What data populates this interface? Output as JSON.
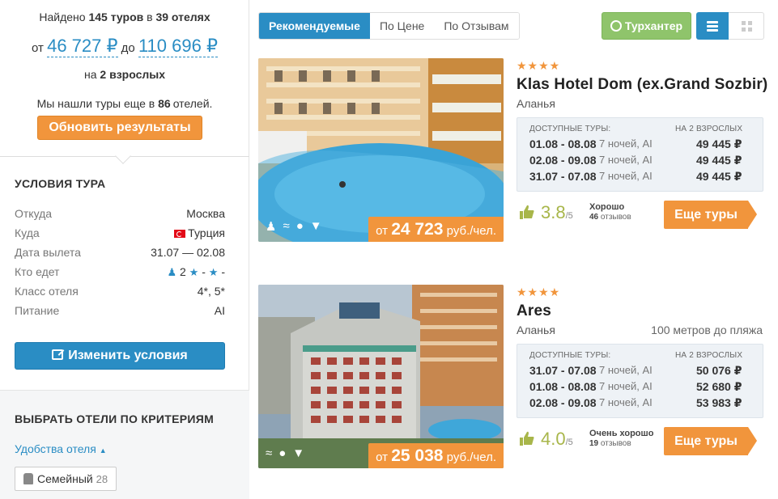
{
  "summary": {
    "found_prefix": "Найдено",
    "tours_count": "145 туров",
    "in": "в",
    "hotels_count": "39 отелях",
    "from_label": "от",
    "price_min": "46 727 ₽",
    "to_label": "до",
    "price_max": "110 696 ₽",
    "adults_prefix": "на",
    "adults": "2 взрослых",
    "more_prefix": "Мы нашли туры еще в",
    "more_count": "86",
    "more_suffix": "отелей.",
    "update_button": "Обновить результаты"
  },
  "conditions": {
    "title": "УСЛОВИЯ ТУРА",
    "rows": [
      {
        "label": "Откуда",
        "value": "Москва"
      },
      {
        "label": "Куда",
        "value": "Турция"
      },
      {
        "label": "Дата вылета",
        "value": "31.07 — 02.08"
      },
      {
        "label": "Кто едет",
        "value": "2"
      },
      {
        "label": "Класс отеля",
        "value": "4*, 5*"
      },
      {
        "label": "Питание",
        "value": "AI"
      }
    ],
    "travellers_sep": "-",
    "change_button": "Изменить условия"
  },
  "filters": {
    "title": "ВЫБРАТЬ ОТЕЛИ ПО КРИТЕРИЯМ",
    "amenities_label": "Удобства отеля",
    "chip_label": "Семейный",
    "chip_count": "28"
  },
  "toolbar": {
    "sort_recommended": "Рекомендуемые",
    "sort_price": "По Цене",
    "sort_reviews": "По Отзывам",
    "hunter_button": "Турхантер"
  },
  "hotels": [
    {
      "stars": "★★★★",
      "name": "Klas Hotel Dom (ex.Grand Sozbir)",
      "city": "Аланья",
      "beach": "",
      "price_from": "от",
      "price": "24 723",
      "price_unit": "руб./чел.",
      "tours_header": "ДОСТУПНЫЕ ТУРЫ:",
      "for_header": "НА 2 ВЗРОСЛЫХ",
      "tours": [
        {
          "dates": "01.08 - 08.08",
          "nights": "7 ночей, AI",
          "price": "49 445 ₽"
        },
        {
          "dates": "02.08 - 09.08",
          "nights": "7 ночей, AI",
          "price": "49 445 ₽"
        },
        {
          "dates": "31.07 - 07.08",
          "nights": "7 ночей, AI",
          "price": "49 445 ₽"
        }
      ],
      "score": "3.8",
      "score_of": "/5",
      "verdict": "Хорошо",
      "reviews_count": "46",
      "reviews_label": "отзывов",
      "more_button": "Еще туры"
    },
    {
      "stars": "★★★★",
      "name": "Ares",
      "city": "Аланья",
      "beach": "100 метров до пляжа",
      "price_from": "от",
      "price": "25 038",
      "price_unit": "руб./чел.",
      "tours_header": "ДОСТУПНЫЕ ТУРЫ:",
      "for_header": "НА 2 ВЗРОСЛЫХ",
      "tours": [
        {
          "dates": "31.07 - 07.08",
          "nights": "7 ночей, AI",
          "price": "50 076 ₽"
        },
        {
          "dates": "01.08 - 08.08",
          "nights": "7 ночей, AI",
          "price": "52 680 ₽"
        },
        {
          "dates": "02.08 - 09.08",
          "nights": "7 ночей, AI",
          "price": "53 983 ₽"
        }
      ],
      "score": "4.0",
      "score_of": "/5",
      "verdict": "Очень хорошо",
      "reviews_count": "19",
      "reviews_label": "отзывов",
      "more_button": "Еще туры"
    }
  ],
  "colors": {
    "primary": "#2a8dc4",
    "accent": "#f1953c",
    "hunter": "#8fc46b",
    "rating": "#a8b64a"
  }
}
